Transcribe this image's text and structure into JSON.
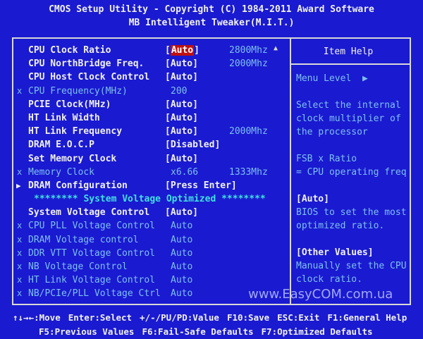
{
  "header": {
    "title_line1": "CMOS Setup Utility - Copyright (C) 1984-2011 Award Software",
    "title_line2": "MB Intelligent Tweaker(M.I.T.)"
  },
  "menu": {
    "items": [
      {
        "label": "CPU Clock Ratio",
        "value_bracket_open": "[",
        "value": "Auto",
        "value_bracket_close": "]",
        "extra": "2800Mhz"
      },
      {
        "label": "CPU NorthBridge Freq.",
        "value": "[Auto]",
        "extra": "2000Mhz"
      },
      {
        "label": "CPU Host Clock Control",
        "value": "[Auto]",
        "extra": ""
      },
      {
        "label": "CPU Frequency(MHz)",
        "value": "200",
        "extra": "",
        "mark": "x"
      },
      {
        "label": "PCIE Clock(MHz)",
        "value": "[Auto]",
        "extra": ""
      },
      {
        "label": "HT Link Width",
        "value": "[Auto]",
        "extra": ""
      },
      {
        "label": "HT Link Frequency",
        "value": "[Auto]",
        "extra": "2000Mhz"
      },
      {
        "label": "DRAM E.O.C.P",
        "value": "[Disabled]",
        "extra": ""
      },
      {
        "label": "Set Memory Clock",
        "value": "[Auto]",
        "extra": ""
      },
      {
        "label": "Memory Clock",
        "value": "x6.66",
        "extra": "1333Mhz",
        "mark": "x"
      },
      {
        "label": "DRAM Configuration",
        "value": "[Press Enter]",
        "extra": "",
        "arrow": "▶"
      },
      {
        "label": "******** System Voltage Optimized ********"
      },
      {
        "label": "System Voltage Control",
        "value": "[Auto]",
        "extra": ""
      },
      {
        "label": "CPU PLL Voltage Control",
        "value": "Auto",
        "mark": "x"
      },
      {
        "label": "DRAM Voltage control",
        "value": "Auto",
        "mark": "x"
      },
      {
        "label": "DDR VTT Voltage Control",
        "value": "Auto",
        "mark": "x"
      },
      {
        "label": "NB Voltage Control",
        "value": "Auto",
        "mark": "x"
      },
      {
        "label": "HT Link Voltage Control",
        "value": "Auto",
        "mark": "x"
      },
      {
        "label": "NB/PCIe/PLL Voltage Ctrl",
        "value": "Auto",
        "mark": "x"
      }
    ],
    "scroll_up_icon": "▲"
  },
  "help": {
    "title": "Item Help",
    "menu_level": "Menu Level",
    "menu_level_arrow": "▶",
    "line1": "Select the internal",
    "line2": "clock multiplier of",
    "line3": "the processor",
    "line4": "FSB x Ratio",
    "line5": "= CPU operating freq",
    "line6": "[Auto]",
    "line7": "BIOS to set the most",
    "line8": "optimized ratio.",
    "line9": "[Other Values]",
    "line10": "Manually set the CPU",
    "line11": "clock ratio."
  },
  "watermark": "www.EasyCOM.com.ua",
  "footer": {
    "k1": "↑↓→←:Move",
    "k2": "Enter:Select",
    "k3": "+/-/PU/PD:Value",
    "k4": "F10:Save",
    "k5": "ESC:Exit",
    "k6": "F1:General Help",
    "k7": "F5:Previous Values",
    "k8": "F6:Fail-Safe Defaults",
    "k9": "F7:Optimized Defaults"
  },
  "colors": {
    "background": "#1a1ad0",
    "text": "#f0f0f0",
    "disabled_text": "#7ec0f0",
    "separator_text": "#40e0e0",
    "selection": "#c01010"
  }
}
